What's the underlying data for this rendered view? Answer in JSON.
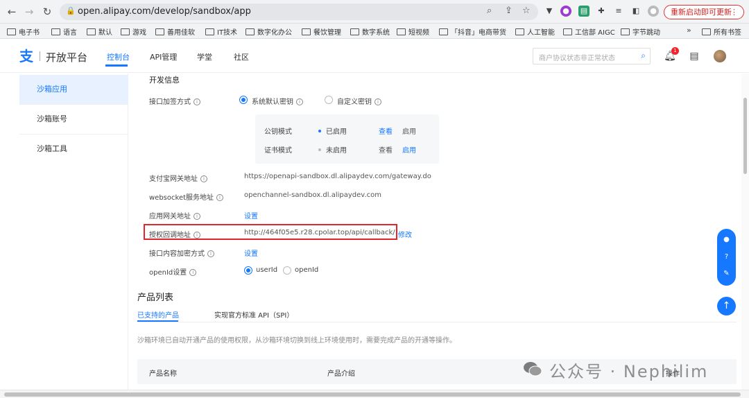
{
  "browser": {
    "url": "open.alipay.com/develop/sandbox/app",
    "restart_label": "重新启动即可更新",
    "bookmarks": [
      "电子书",
      "语言",
      "默认",
      "游戏",
      "善用佳软",
      "IT技术",
      "数字化办公",
      "餐饮管理",
      "数字系统",
      "短视频",
      "「抖音」电商带货",
      "人工智能",
      "工信部 AIGC",
      "字节跳动"
    ],
    "more_label": "»",
    "all_bookmarks": "所有书签"
  },
  "header": {
    "logo_text": "开放平台",
    "nav": [
      "控制台",
      "API管理",
      "学堂",
      "社区"
    ],
    "search_placeholder": "商户协议状态非正常状态",
    "badge_count": "1"
  },
  "sidebar": {
    "items": [
      "沙箱应用",
      "沙箱账号",
      "沙箱工具"
    ]
  },
  "dev_info": {
    "title": "开发信息",
    "sign_method_label": "接口加签方式",
    "sign_options": [
      "系统默认密钥",
      "自定义密钥"
    ],
    "key_modes": [
      {
        "mode": "公钥模式",
        "status": "已启用",
        "view": "查看",
        "action": "启用"
      },
      {
        "mode": "证书模式",
        "status": "未启用",
        "view": "查看",
        "action": "启用"
      }
    ],
    "gateway_label": "支付宝网关地址",
    "gateway_value": "https://openapi-sandbox.dl.alipaydev.com/gateway.do",
    "websocket_label": "websocket服务地址",
    "websocket_value": "openchannel-sandbox.dl.alipaydev.com",
    "app_gateway_label": "应用网关地址",
    "app_gateway_link": "设置",
    "callback_label": "授权回调地址",
    "callback_value": "http://464f05e5.r28.cpolar.top/api/callback/",
    "callback_edit": "修改",
    "encrypt_label": "接口内容加密方式",
    "encrypt_link": "设置",
    "openid_label": "openId设置",
    "openid_options": [
      "userId",
      "openId"
    ]
  },
  "products": {
    "title": "产品列表",
    "tabs": [
      "已支持的产品",
      "实现官方标准 API（SPI）"
    ],
    "note": "沙箱环境已自动开通产品的使用权限，从沙箱环境切换到线上环境使用时，需要完成产品的开通等操作。",
    "columns": [
      "产品名称",
      "产品介绍",
      "操作"
    ]
  },
  "watermark": "公众号 · Nephilim",
  "colors": {
    "accent": "#1677ff",
    "highlight": "#e0262c"
  }
}
